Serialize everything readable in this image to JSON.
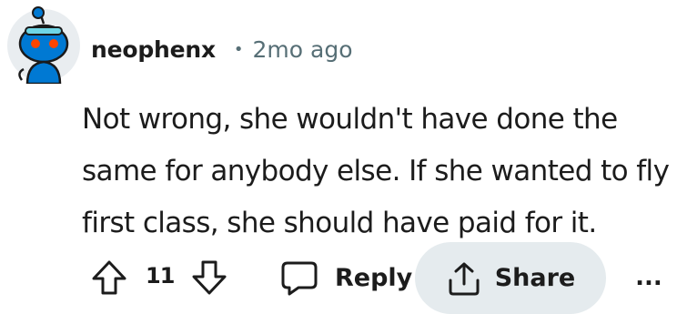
{
  "comment": {
    "author": "neophenx",
    "separator": "•",
    "timestamp": "2mo ago",
    "body": "Not wrong, she wouldn't have done the same for anybody else. If she wanted to fly first class, she should have paid for it."
  },
  "actions": {
    "vote_count": "11",
    "reply_label": "Reply",
    "share_label": "Share",
    "more_label": "..."
  },
  "icons": {
    "upvote": "arrow-up-outline",
    "downvote": "arrow-down-outline",
    "reply": "speech-bubble-outline",
    "share": "share-upload-outline",
    "more": "horizontal-ellipsis"
  },
  "colors": {
    "text": "#1c1c1c",
    "meta": "#576f76",
    "share_bg": "#e5ebee",
    "avatar_bg": "#e9edf0",
    "avatar_body": "#0079d3"
  }
}
